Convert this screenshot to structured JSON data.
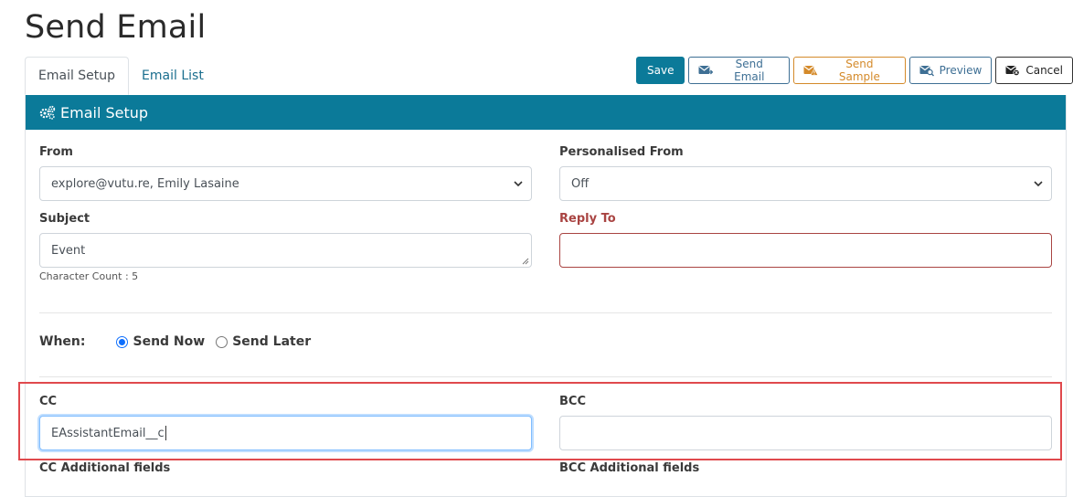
{
  "page": {
    "title": "Send Email"
  },
  "tabs": [
    {
      "label": "Email Setup",
      "active": true
    },
    {
      "label": "Email List",
      "active": false
    }
  ],
  "toolbar": {
    "save_label": "Save",
    "send_email_label": "Send Email",
    "send_sample_label": "Send Sample",
    "preview_label": "Preview",
    "cancel_label": "Cancel"
  },
  "panel": {
    "title": "Email Setup",
    "icon": "gears-icon"
  },
  "form": {
    "from": {
      "label": "From",
      "value": "explore@vutu.re, Emily Lasaine"
    },
    "personalised_from": {
      "label": "Personalised From",
      "value": "Off"
    },
    "subject": {
      "label": "Subject",
      "value": "Event",
      "char_count": "Character Count : 5"
    },
    "reply_to": {
      "label": "Reply To",
      "value": ""
    },
    "when": {
      "label": "When:",
      "options": [
        "Send Now",
        "Send Later"
      ],
      "selected": "Send Now"
    },
    "cc": {
      "label": "CC",
      "value": "EAssistantEmail__c"
    },
    "bcc": {
      "label": "BCC",
      "value": ""
    },
    "cc_additional": {
      "label": "CC Additional fields"
    },
    "bcc_additional": {
      "label": "BCC Additional fields"
    }
  },
  "colors": {
    "primary": "#0b7a99",
    "warning": "#d48a2a",
    "danger": "#a94442",
    "highlight": "#e0494d"
  }
}
